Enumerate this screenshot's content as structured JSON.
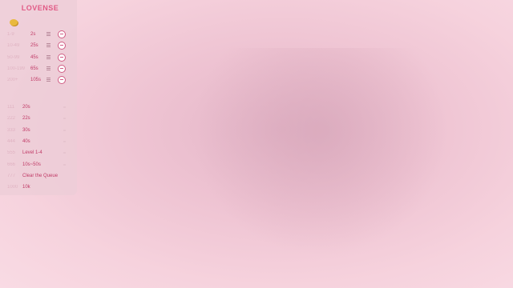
{
  "panel": {
    "logo": "LOVENSE",
    "levels": [
      {
        "tokens": "1-9",
        "duration": "2s"
      },
      {
        "tokens": "10-49",
        "duration": "25s"
      },
      {
        "tokens": "50-99",
        "duration": "45s"
      },
      {
        "tokens": "100-199",
        "duration": "65s"
      },
      {
        "tokens": "200+",
        "duration": "105s"
      }
    ],
    "specials": [
      {
        "tokens": "111",
        "label": "20s"
      },
      {
        "tokens": "222",
        "label": "22s"
      },
      {
        "tokens": "333",
        "label": "30s"
      },
      {
        "tokens": "444",
        "label": "40s"
      },
      {
        "tokens": "555",
        "label": "Level 1-4"
      },
      {
        "tokens": "666",
        "label": "10s~50s"
      },
      {
        "tokens": "777",
        "label": "Clear the Queue"
      },
      {
        "tokens": "1000",
        "label": "10k"
      }
    ]
  },
  "colors": {
    "accent": "#c03a66",
    "logo": "#e15a86",
    "coin": "#e9b93e"
  }
}
